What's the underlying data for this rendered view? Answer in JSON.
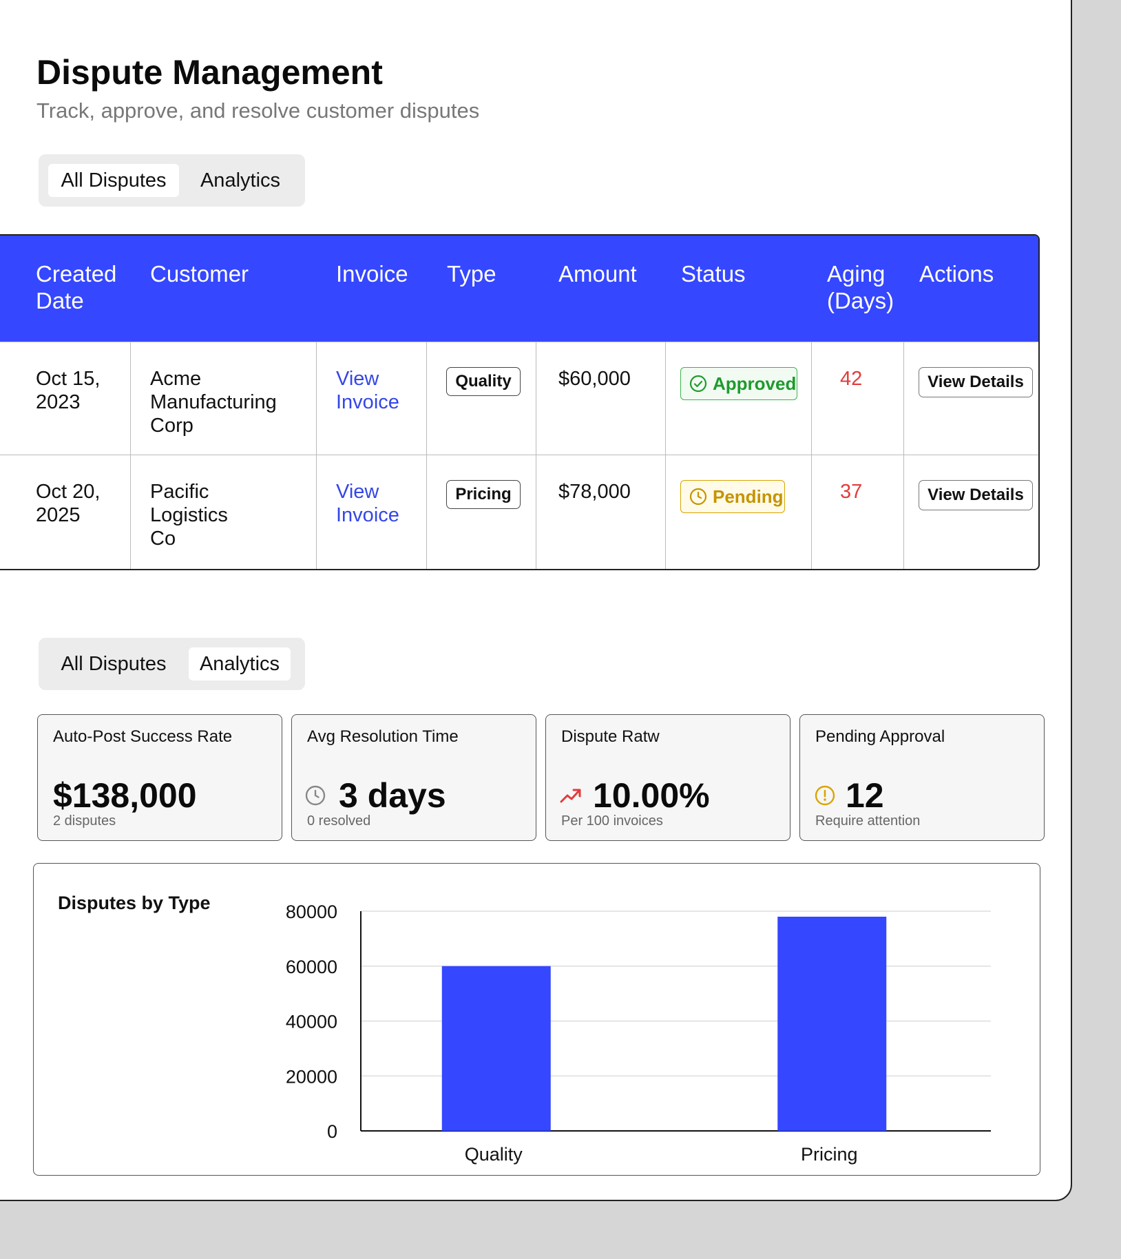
{
  "header": {
    "title": "Dispute Management",
    "subtitle": "Track, approve, and resolve customer disputes"
  },
  "tabs": {
    "all_disputes": "All Disputes",
    "analytics": "Analytics"
  },
  "table": {
    "columns": [
      "Created Date",
      "Customer",
      "Invoice",
      "Type",
      "Amount",
      "Status",
      "Aging (Days)",
      "Actions"
    ],
    "rows": [
      {
        "created_date": "Oct 15, 2023",
        "customer": "Acme Manufacturing Corp",
        "invoice": "View Invoice",
        "type": "Quality",
        "amount": "$60,000",
        "status": "Approved",
        "aging": "42",
        "action": "View Details"
      },
      {
        "created_date": "Oct 20, 2025",
        "customer": "Pacific Logistics Co",
        "invoice": "View Invoice",
        "type": "Pricing",
        "amount": "$78,000",
        "status": "Pending",
        "aging": "37",
        "action": "View Details"
      }
    ]
  },
  "stats": [
    {
      "title": "Auto-Post Success Rate",
      "value": "$138,000",
      "sub": "2 disputes",
      "icon": "none"
    },
    {
      "title": "Avg Resolution Time",
      "value": "3 days",
      "sub": "0 resolved",
      "icon": "clock-icon"
    },
    {
      "title": "Dispute Ratw",
      "value": "10.00%",
      "sub": "Per 100 invoices",
      "icon": "trending-up-icon"
    },
    {
      "title": "Pending Approval",
      "value": "12",
      "sub": "Require attention",
      "icon": "alert-circle-icon"
    }
  ],
  "colors": {
    "accent": "#3547ff",
    "approved": "#1f9a2e",
    "pending": "#c69300",
    "aging": "#e23b3b",
    "link": "#3446e8"
  },
  "chart_data": {
    "type": "bar",
    "title": "Disputes by Type",
    "categories": [
      "Quality",
      "Pricing"
    ],
    "values": [
      60000,
      78000
    ],
    "ylim": [
      0,
      80000
    ],
    "yticks": [
      0,
      20000,
      40000,
      60000,
      80000
    ],
    "grid": true,
    "legend": "none",
    "bar_color": "#3547ff"
  }
}
